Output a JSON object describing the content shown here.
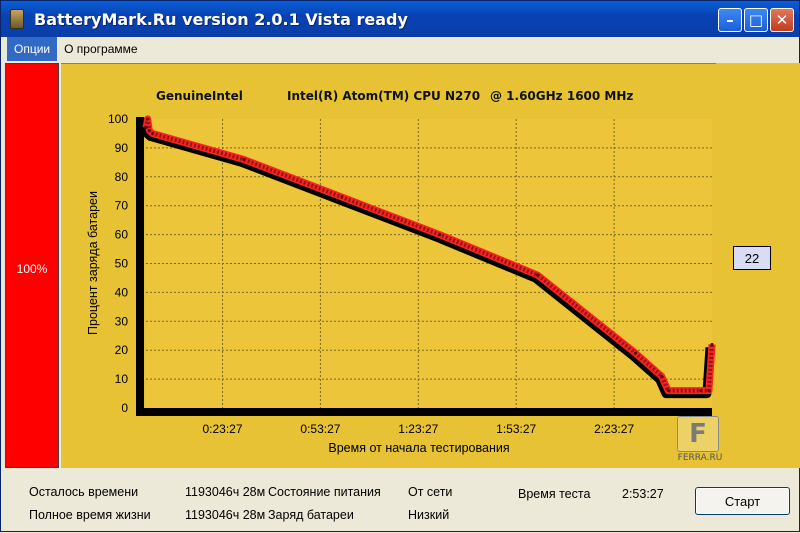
{
  "window": {
    "title": "BatteryMark.Ru version 2.0.1 Vista ready"
  },
  "menu": {
    "options": "Опции",
    "about": "О программе"
  },
  "battery": {
    "percent_label": "100%"
  },
  "header": {
    "vendor": "GenuineIntel",
    "cpu": "Intel(R) Atom(TM) CPU N270",
    "freq": "@ 1.60GHz 1600 MHz"
  },
  "side_value": "22",
  "status": {
    "remaining_label": "Осталось времени",
    "remaining_value": "1193046ч 28м",
    "lifetime_label": "Полное время жизни",
    "lifetime_value": "1193046ч 28м",
    "power_label": "Состояние питания",
    "power_value": "От сети",
    "charge_label": "Заряд батареи",
    "charge_value": "Низкий",
    "test_time_label": "Время теста",
    "test_time_value": "2:53:27"
  },
  "start_button": "Старт",
  "watermark": "FERRA.RU",
  "watermark_logo": "F",
  "chart_data": {
    "type": "line",
    "title": "",
    "xlabel": "Время от начала тестирования",
    "ylabel": "Процент заряда батареи",
    "ylim": [
      0,
      100
    ],
    "yticks": [
      0,
      10,
      20,
      30,
      40,
      50,
      60,
      70,
      80,
      90,
      100
    ],
    "xticks": [
      "0:23:27",
      "0:53:27",
      "1:23:27",
      "1:53:27",
      "2:23:27"
    ],
    "xtick_minutes": [
      23.45,
      53.45,
      83.45,
      113.45,
      143.45
    ],
    "grid": true,
    "series": [
      {
        "x_minutes": [
          0,
          0.5,
          1,
          2,
          30,
          60,
          90,
          120,
          150,
          158,
          160,
          170,
          172.5,
          173.45
        ],
        "values": [
          97,
          100,
          96,
          95,
          86,
          73,
          60,
          46,
          19,
          11,
          6,
          6,
          6,
          22
        ],
        "color": "#8b1a1a"
      }
    ]
  }
}
